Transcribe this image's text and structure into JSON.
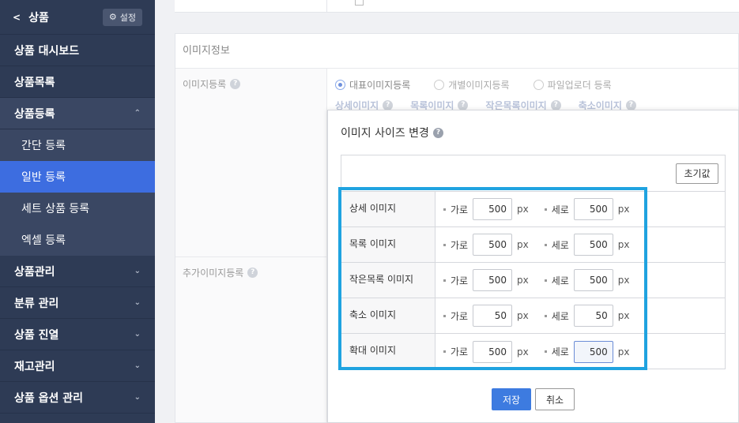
{
  "sidebar": {
    "back_label": "상품",
    "settings_label": "설정",
    "items": [
      {
        "label": "상품 대시보드"
      },
      {
        "label": "상품목록"
      },
      {
        "label": "상품등록"
      },
      {
        "label": "간단 등록"
      },
      {
        "label": "일반 등록"
      },
      {
        "label": "세트 상품 등록"
      },
      {
        "label": "엑셀 등록"
      },
      {
        "label": "상품관리"
      },
      {
        "label": "분류 관리"
      },
      {
        "label": "상품 진열"
      },
      {
        "label": "재고관리"
      },
      {
        "label": "상품 옵션 관리"
      }
    ]
  },
  "main": {
    "section_title": "이미지정보",
    "image_reg_label": "이미지등록",
    "extra_image_label": "추가이미지등록",
    "radios": [
      "대표이미지등록",
      "개별이미지등록",
      "파일업로더 등록"
    ],
    "tabs": [
      "상세이미지",
      "목록이미지",
      "작은목록이미지",
      "축소이미지"
    ]
  },
  "modal": {
    "title": "이미지 사이즈 변경",
    "reset_label": "초기값",
    "width_label": "가로",
    "height_label": "세로",
    "unit": "px",
    "rows": [
      {
        "label": "상세 이미지",
        "width": "500",
        "height": "500"
      },
      {
        "label": "목록 이미지",
        "width": "500",
        "height": "500"
      },
      {
        "label": "작은목록 이미지",
        "width": "500",
        "height": "500"
      },
      {
        "label": "축소 이미지",
        "width": "50",
        "height": "50"
      },
      {
        "label": "확대 이미지",
        "width": "500",
        "height": "500"
      }
    ],
    "save_label": "저장",
    "cancel_label": "취소"
  },
  "colors": {
    "sidebar": "#2e3b55",
    "active": "#3d6de0",
    "highlight": "#1fa3e0"
  }
}
